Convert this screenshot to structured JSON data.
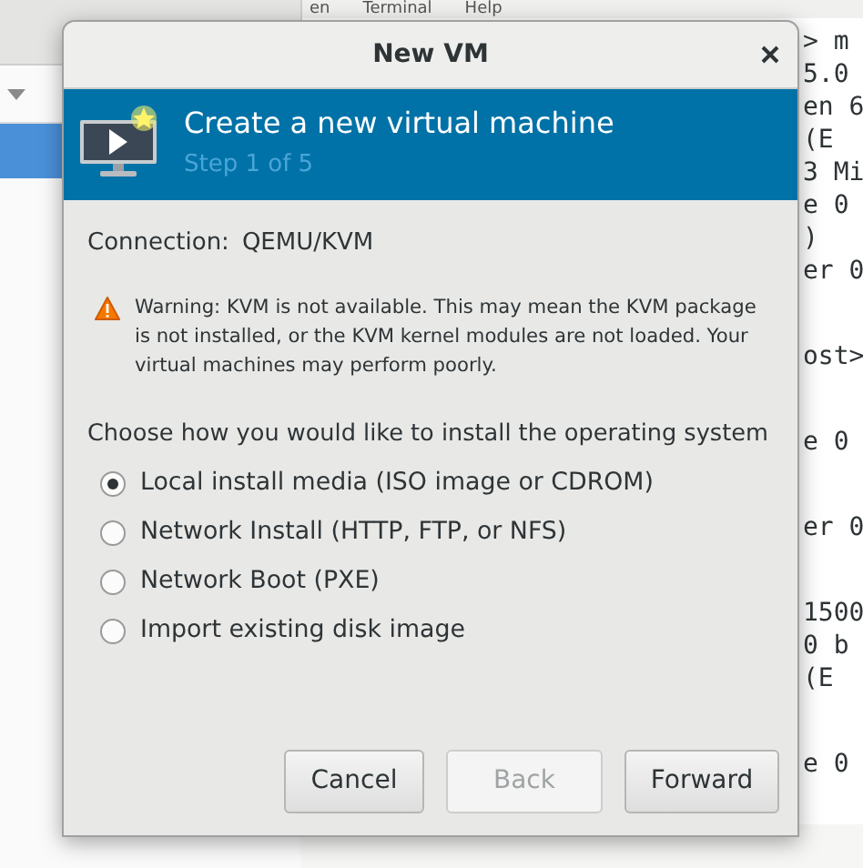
{
  "background": {
    "terminal_menu": [
      "en",
      "Terminal",
      "Help"
    ],
    "terminal_blocks": [
      [
        "> m",
        "5.0",
        "en 6",
        "(E",
        "3 Mi",
        "e 0",
        ")",
        "er 0"
      ],
      [
        "ost>"
      ],
      [
        "e 0"
      ],
      [
        "er 0"
      ],
      [
        "1500",
        "0 b",
        "(E"
      ],
      [
        "e 0"
      ]
    ]
  },
  "dialog": {
    "title": "New VM",
    "banner": {
      "title": "Create a new virtual machine",
      "step": "Step 1 of 5"
    },
    "connection": {
      "label": "Connection:",
      "value": "QEMU/KVM"
    },
    "warning": "Warning: KVM is not available. This may mean the KVM package is not installed, or the KVM kernel modules are not loaded. Your virtual machines may perform poorly.",
    "prompt": "Choose how you would like to install the operating system",
    "options": [
      {
        "label": "Local install media (ISO image or CDROM)",
        "selected": true
      },
      {
        "label": "Network Install (HTTP, FTP, or NFS)",
        "selected": false
      },
      {
        "label": "Network Boot (PXE)",
        "selected": false
      },
      {
        "label": "Import existing disk image",
        "selected": false
      }
    ],
    "buttons": [
      {
        "label": "Cancel",
        "disabled": false
      },
      {
        "label": "Back",
        "disabled": true
      },
      {
        "label": "Forward",
        "disabled": false
      }
    ]
  }
}
